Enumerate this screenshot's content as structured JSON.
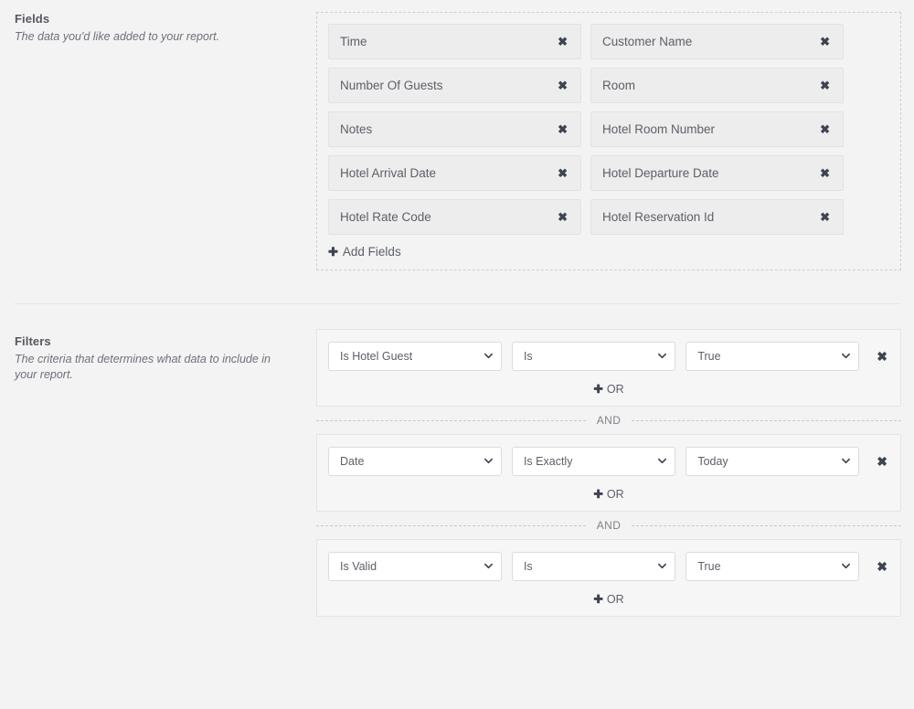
{
  "fields": {
    "title": "Fields",
    "description": "The data you'd like added to your report.",
    "items": [
      {
        "label": "Time",
        "remove_icon": "close-icon"
      },
      {
        "label": "Customer Name",
        "remove_icon": "close-icon"
      },
      {
        "label": "Number Of Guests",
        "remove_icon": "close-icon"
      },
      {
        "label": "Room",
        "remove_icon": "close-icon"
      },
      {
        "label": "Notes",
        "remove_icon": "close-icon"
      },
      {
        "label": "Hotel Room Number",
        "remove_icon": "close-icon"
      },
      {
        "label": "Hotel Arrival Date",
        "remove_icon": "close-icon"
      },
      {
        "label": "Hotel Departure Date",
        "remove_icon": "close-icon"
      },
      {
        "label": "Hotel Rate Code",
        "remove_icon": "close-icon"
      },
      {
        "label": "Hotel Reservation Id",
        "remove_icon": "close-icon"
      }
    ],
    "add_label": "Add Fields",
    "add_icon": "plus-icon",
    "remove_glyph": "✖"
  },
  "filters": {
    "title": "Filters",
    "description": "The criteria that determines what data to include in your report.",
    "or_label": "OR",
    "or_icon": "plus-icon",
    "and_label": "AND",
    "remove_glyph": "✖",
    "groups": [
      {
        "field": "Is Hotel Guest",
        "operator": "Is",
        "value": "True",
        "or_label": "OR",
        "remove_icon": "close-icon"
      },
      {
        "field": "Date",
        "operator": "Is Exactly",
        "value": "Today",
        "or_label": "OR",
        "remove_icon": "close-icon"
      },
      {
        "field": "Is Valid",
        "operator": "Is",
        "value": "True",
        "or_label": "OR",
        "remove_icon": "close-icon"
      }
    ]
  },
  "colors": {
    "page_background": "#f3f3f3",
    "pill_background": "#ededed",
    "group_background": "#f6f6f6",
    "text": "#55585e",
    "icon": "#3e4352"
  }
}
